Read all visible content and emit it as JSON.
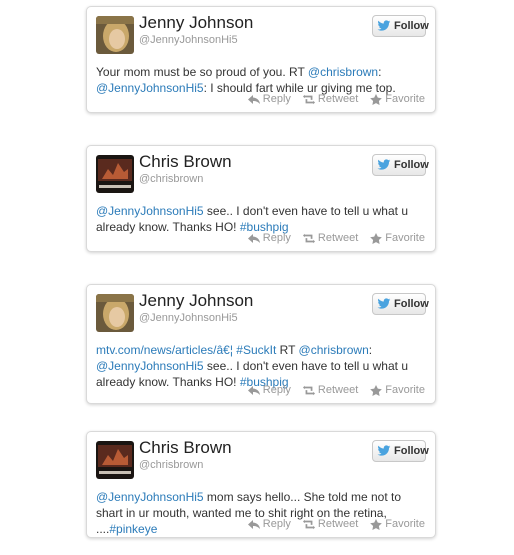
{
  "colors": {
    "link": "#2b7bb9",
    "bird": "#4aa3df",
    "meta": "#999999"
  },
  "labels": {
    "follow": "Follow",
    "reply": "Reply",
    "retweet": "Retweet",
    "favorite": "Favorite"
  },
  "tweets": [
    {
      "name": "Jenny Johnson",
      "handle": "@JennyJohnsonHi5",
      "avatar_icon": "jenny-avatar",
      "segments": [
        {
          "t": "Your mom must be so proud of you. RT "
        },
        {
          "t": "@chrisbrown",
          "link": true
        },
        {
          "t": ": "
        },
        {
          "t": "@JennyJohnsonHi5",
          "link": true
        },
        {
          "t": ": I should fart while ur giving me top."
        }
      ]
    },
    {
      "name": "Chris Brown",
      "handle": "@chrisbrown",
      "avatar_icon": "chris-avatar",
      "segments": [
        {
          "t": "@JennyJohnsonHi5",
          "link": true
        },
        {
          "t": " see.. I don't even have to tell u what u already know. Thanks HO! "
        },
        {
          "t": "#bushpig",
          "link": true
        }
      ]
    },
    {
      "name": "Jenny Johnson",
      "handle": "@JennyJohnsonHi5",
      "avatar_icon": "jenny-avatar",
      "segments": [
        {
          "t": "mtv.com/news/articles/â€¦",
          "link": true
        },
        {
          "t": " "
        },
        {
          "t": "#SuckIt",
          "link": true
        },
        {
          "t": " RT "
        },
        {
          "t": "@chrisbrown",
          "link": true
        },
        {
          "t": ": "
        },
        {
          "t": "@JennyJohnsonHi5",
          "link": true
        },
        {
          "t": " see.. I don't even have to tell u what u already know. Thanks HO! "
        },
        {
          "t": "#bushpig",
          "link": true
        }
      ]
    },
    {
      "name": "Chris Brown",
      "handle": "@chrisbrown",
      "avatar_icon": "chris-avatar",
      "segments": [
        {
          "t": "@JennyJohnsonHi5",
          "link": true
        },
        {
          "t": " mom says hello... She told me not to shart in ur mouth, wanted me to shit right on the retina, ...."
        },
        {
          "t": "#pinkeye",
          "link": true
        }
      ]
    }
  ]
}
